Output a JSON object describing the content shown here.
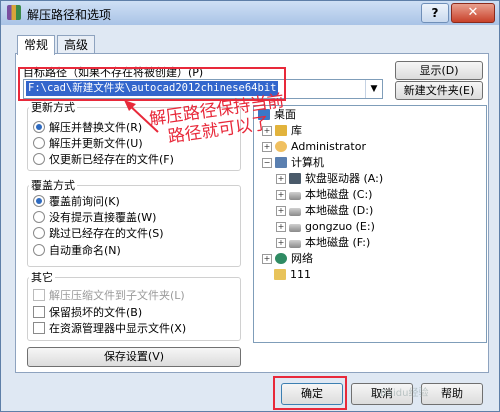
{
  "window": {
    "title": "解压路径和选项",
    "help_label": "?",
    "close_label": "✕"
  },
  "tabs": [
    {
      "label": "常规",
      "active": true
    },
    {
      "label": "高级",
      "active": false
    }
  ],
  "target_path": {
    "label": "目标路径（如果不存在将被创建）(P)",
    "value": "F:\\cad\\新建文件夹\\autocad2012chinese64bit",
    "show_button": "显示(D)",
    "new_folder_button": "新建文件夹(E)"
  },
  "update_mode": {
    "title": "更新方式",
    "options": [
      {
        "label": "解压并替换文件(R)",
        "selected": true
      },
      {
        "label": "解压并更新文件(U)",
        "selected": false
      },
      {
        "label": "仅更新已经存在的文件(F)",
        "selected": false
      }
    ]
  },
  "overwrite_mode": {
    "title": "覆盖方式",
    "options": [
      {
        "label": "覆盖前询问(K)",
        "selected": true
      },
      {
        "label": "没有提示直接覆盖(W)",
        "selected": false
      },
      {
        "label": "跳过已经存在的文件(S)",
        "selected": false
      },
      {
        "label": "自动重命名(N)",
        "selected": false
      }
    ]
  },
  "misc": {
    "title": "其它",
    "options": [
      {
        "label": "解压压缩文件到子文件夹(L)",
        "checked": false,
        "disabled": true
      },
      {
        "label": "保留损坏的文件(B)",
        "checked": false,
        "disabled": false
      },
      {
        "label": "在资源管理器中显示文件(X)",
        "checked": false,
        "disabled": false
      }
    ],
    "save_button": "保存设置(V)"
  },
  "tree": [
    {
      "label": "桌面",
      "icon": "desktop-icon",
      "expander": ""
    },
    {
      "label": "库",
      "icon": "library-icon",
      "expander": "+"
    },
    {
      "label": "Administrator",
      "icon": "user-icon",
      "expander": "+"
    },
    {
      "label": "计算机",
      "icon": "computer-icon",
      "expander": "−"
    },
    {
      "label": "软盘驱动器 (A:)",
      "icon": "floppy-icon",
      "expander": "+"
    },
    {
      "label": "本地磁盘 (C:)",
      "icon": "disk-icon",
      "expander": "+"
    },
    {
      "label": "本地磁盘 (D:)",
      "icon": "disk-icon",
      "expander": "+"
    },
    {
      "label": "gongzuo (E:)",
      "icon": "disk-icon",
      "expander": "+"
    },
    {
      "label": "本地磁盘 (F:)",
      "icon": "disk-icon",
      "expander": "+"
    },
    {
      "label": "网络",
      "icon": "network-icon",
      "expander": "+"
    },
    {
      "label": "111",
      "icon": "folder-icon",
      "expander": ""
    }
  ],
  "annotation": {
    "line1": "解压路径保持当前",
    "line2": "路径就可以了"
  },
  "footer": {
    "ok": "确定",
    "cancel": "取消",
    "help": "帮助"
  },
  "watermark": "Baidu经验"
}
